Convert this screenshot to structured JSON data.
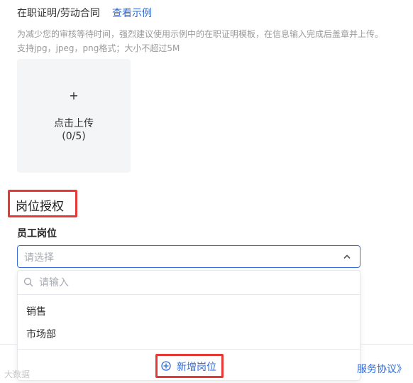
{
  "proof": {
    "title": "在职证明/劳动合同",
    "example_link": "查看示例",
    "hint_line1": "为减少您的审核等待时间，强烈建议使用示例中的在职证明模板，在信息输入完成后盖章并上传。",
    "hint_line2": "支持jpg，jpeg，png格式；大小不超过5M"
  },
  "upload": {
    "plus": "+",
    "label": "点击上传",
    "count": "(0/5)"
  },
  "section": {
    "title": "岗位授权"
  },
  "position_field": {
    "label": "员工岗位",
    "placeholder": "请选择"
  },
  "dropdown": {
    "search_placeholder": "请输入",
    "options": [
      "销售",
      "市场部"
    ],
    "add_label": "新增岗位"
  },
  "footer": {
    "agreement_text": "服务协议》",
    "watermark": "大数据"
  },
  "colors": {
    "accent": "#2f6bd8",
    "highlight": "#e53935"
  }
}
